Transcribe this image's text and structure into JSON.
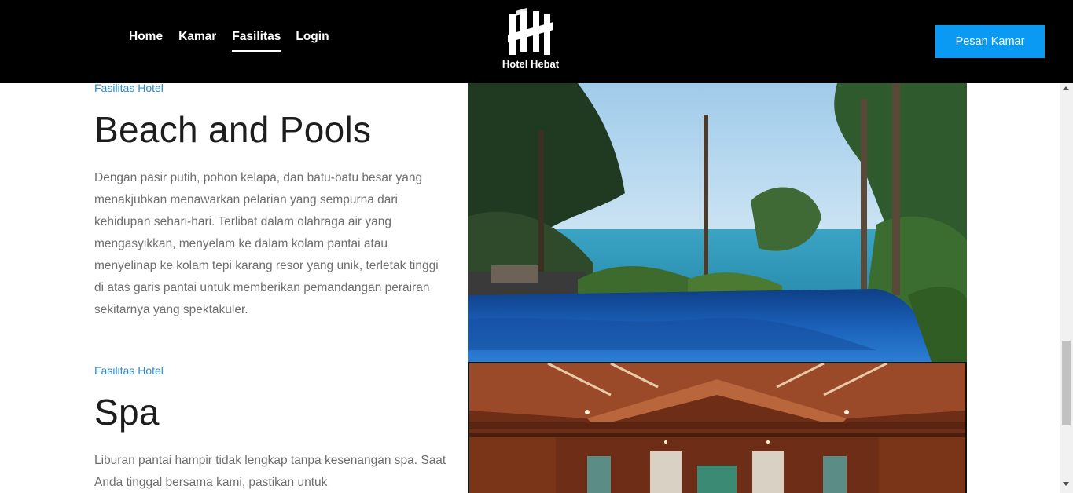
{
  "header": {
    "nav": [
      {
        "label": "Home",
        "active": false
      },
      {
        "label": "Kamar",
        "active": false
      },
      {
        "label": "Fasilitas",
        "active": true
      },
      {
        "label": "Login",
        "active": false
      }
    ],
    "logo_text": "Hotel Hebat",
    "logo_icon": "hotel-hebat-logo-icon",
    "book_button": "Pesan Kamar"
  },
  "sections": [
    {
      "label": "Fasilitas Hotel",
      "title": "Beach and Pools",
      "text": "Dengan pasir putih, pohon kelapa, dan batu-batu besar yang menakjubkan menawarkan pelarian yang sempurna dari kehidupan sehari-hari. Terlibat dalam olahraga air yang mengasyikkan, menyelam ke dalam kolam pantai atau menyelinap ke kolam tepi karang resor yang unik, terletak tinggi di atas garis pantai untuk memberikan pemandangan perairan sekitarnya yang spektakuler."
    },
    {
      "label": "Fasilitas Hotel",
      "title": "Spa",
      "text": "Liburan pantai hampir tidak lengkap tanpa kesenangan spa. Saat Anda tinggal bersama kami, pastikan untuk"
    }
  ],
  "colors": {
    "header_bg": "#000000",
    "accent": "#0a9af3",
    "label": "#2a8ccf",
    "title": "#1d1d1d",
    "body_text": "#6e6e6e"
  }
}
